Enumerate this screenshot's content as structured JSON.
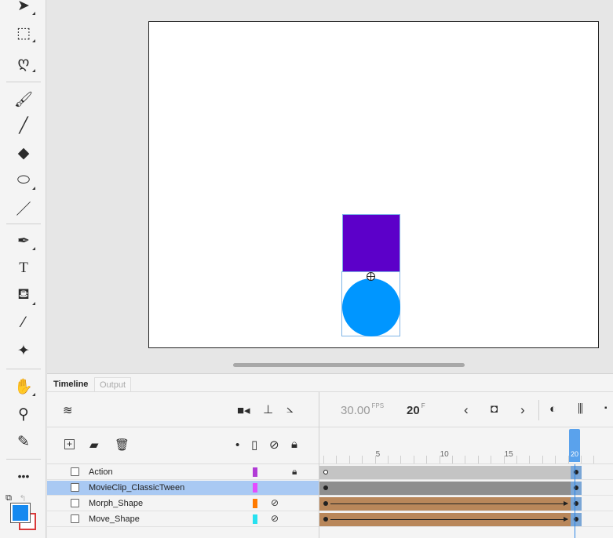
{
  "toolbar": {
    "tools": [
      {
        "name": "selection-tool",
        "glyph": "➤"
      },
      {
        "name": "free-transform-tool",
        "glyph": "⬚"
      },
      {
        "name": "lasso-tool",
        "glyph": "ღ"
      },
      {
        "name": "paint-brush-tool",
        "glyph": "🖌"
      },
      {
        "name": "brush-tool",
        "glyph": "╱"
      },
      {
        "name": "eraser-tool",
        "glyph": "◆"
      },
      {
        "name": "oval-tool",
        "glyph": "⬭"
      },
      {
        "name": "line-tool",
        "glyph": "／"
      },
      {
        "name": "pen-tool",
        "glyph": "✒"
      },
      {
        "name": "text-tool",
        "glyph": "T"
      },
      {
        "name": "paint-bucket-tool",
        "glyph": "⛾"
      },
      {
        "name": "eyedropper-tool",
        "glyph": "⁄"
      },
      {
        "name": "pin-tool",
        "glyph": "✦"
      },
      {
        "name": "hand-tool",
        "glyph": "✋"
      },
      {
        "name": "zoom-tool",
        "glyph": "⚲"
      },
      {
        "name": "pencil-tool",
        "glyph": "✎"
      },
      {
        "name": "more-tools",
        "glyph": "•••"
      }
    ],
    "fill_color": "#1589f0",
    "stroke_color": "#d93a3a"
  },
  "stage": {
    "background": "#ffffff",
    "rect_color": "#5c00c9",
    "circle_color": "#0096ff"
  },
  "panel": {
    "tab_timeline": "Timeline",
    "tab_output": "Output",
    "fps_value": "30.00",
    "fps_unit": "FPS",
    "current_frame": "20",
    "frame_unit": "F",
    "ruler_labels": [
      "5",
      "10",
      "15",
      "20"
    ],
    "layers": [
      {
        "name": "Action",
        "color": "#b13bd6",
        "hidden": false,
        "locked": true,
        "selected": false,
        "span_color": "#c4c4c4",
        "tween": false
      },
      {
        "name": "MovieClip_ClassicTween",
        "color": "#e34dff",
        "hidden": false,
        "locked": false,
        "selected": true,
        "span_color": "#8e8e8e",
        "tween": false
      },
      {
        "name": "Morph_Shape",
        "color": "#ff7a00",
        "hidden": true,
        "locked": false,
        "selected": false,
        "span_color": "#b9875a",
        "tween": true
      },
      {
        "name": "Move_Shape",
        "color": "#27e1f0",
        "hidden": true,
        "locked": false,
        "selected": false,
        "span_color": "#b9875a",
        "tween": true
      }
    ]
  }
}
